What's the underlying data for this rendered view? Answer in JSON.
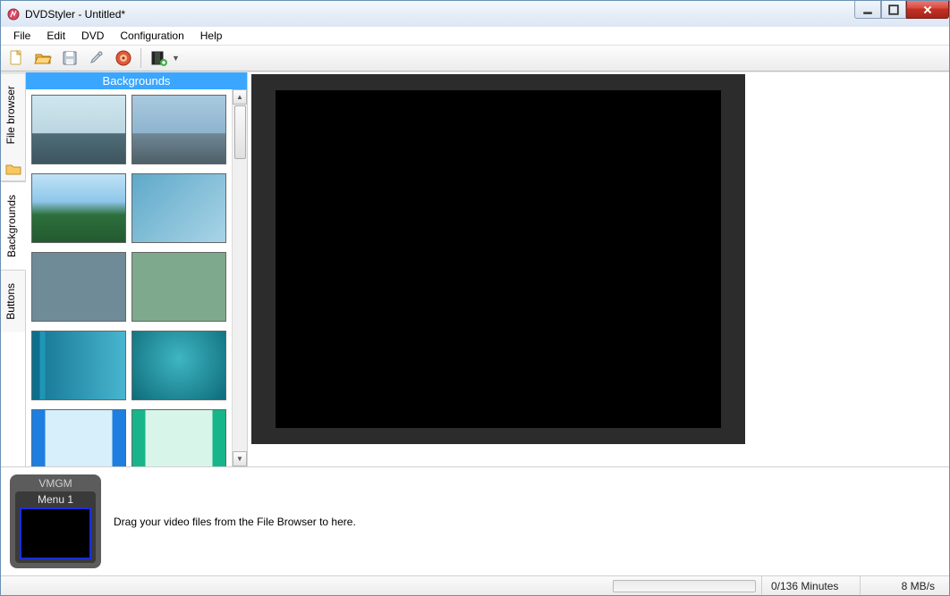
{
  "window": {
    "title": "DVDStyler - Untitled*"
  },
  "menu": {
    "file": "File",
    "edit": "Edit",
    "dvd": "DVD",
    "configuration": "Configuration",
    "help": "Help"
  },
  "side_tabs": {
    "file_browser": "File browser",
    "backgrounds": "Backgrounds",
    "buttons": "Buttons"
  },
  "bg_panel": {
    "header": "Backgrounds"
  },
  "timeline": {
    "vmgm": "VMGM",
    "menu1": "Menu 1",
    "hint": "Drag your video files from the File Browser to here."
  },
  "status": {
    "minutes": "0/136 Minutes",
    "rate": "8 MB/s"
  }
}
